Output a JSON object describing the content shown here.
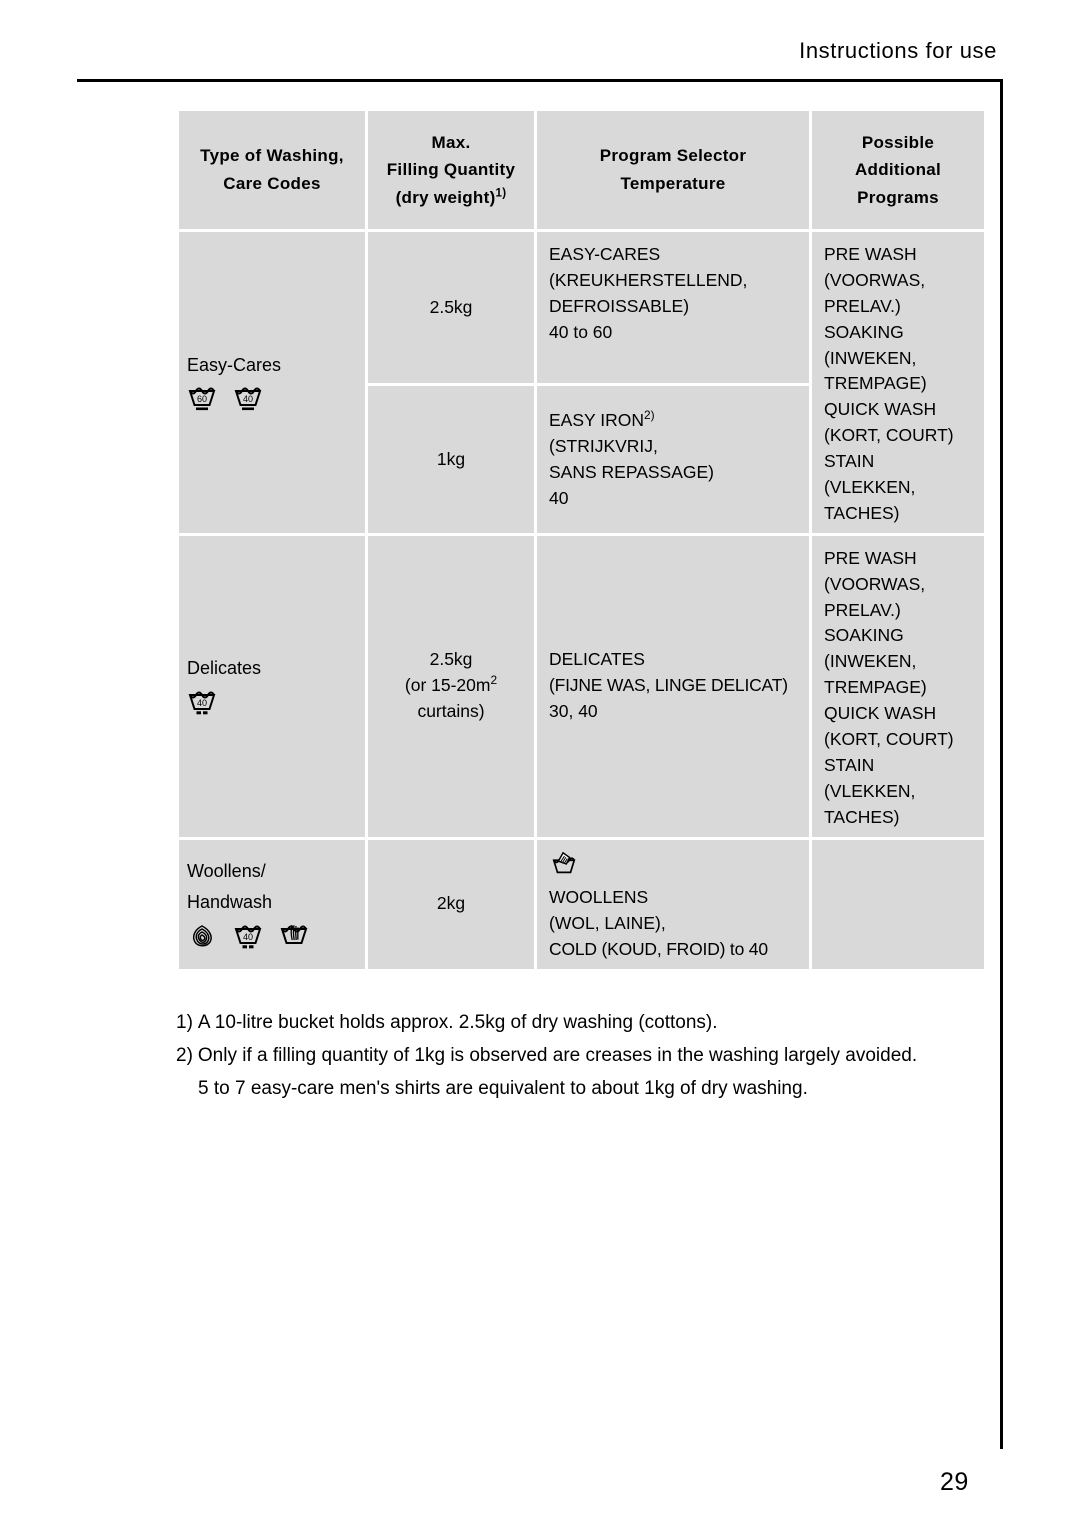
{
  "header": {
    "title": "Instructions for use"
  },
  "page_number": "29",
  "table": {
    "columns": [
      {
        "lines": [
          "Type of Washing,",
          "Care Codes"
        ]
      },
      {
        "lines": [
          "Max.",
          "Filling Quantity",
          "(dry weight)1)"
        ]
      },
      {
        "lines": [
          "Program Selector",
          "Temperature"
        ]
      },
      {
        "lines": [
          "Possible",
          "Additional",
          "Programs"
        ]
      }
    ],
    "col_headers": {
      "c1_l1": "Type of Washing,",
      "c1_l2": "Care Codes",
      "c2_l1": "Max.",
      "c2_l2": "Filling Quantity",
      "c2_l3_pre": "(dry weight)",
      "c2_l3_sup": "1)",
      "c3_l1": "Program Selector",
      "c3_l2": "Temperature",
      "c4_l1": "Possible",
      "c4_l2": "Additional",
      "c4_l3": "Programs"
    },
    "rows": [
      {
        "type_name": "Easy-Cares",
        "icons": [
          "wash-tub-60-gentle-icon",
          "wash-tub-40-gentle-icon"
        ],
        "sub_rows": [
          {
            "quantity": "2.5kg",
            "program_lines": [
              "EASY-CARES",
              "(KREUKHERSTELLEND,",
              "DEFROISSABLE)",
              "40 to 60"
            ]
          },
          {
            "quantity": "1kg",
            "program_pre": "EASY IRON",
            "program_sup": "2)",
            "program_lines": [
              "(STRIJKVRIJ,",
              "SANS REPASSAGE)",
              "40"
            ]
          }
        ],
        "additional_lines": [
          "PRE WASH",
          "(VOORWAS,",
          "PRELAV.)",
          "SOAKING",
          "(INWEKEN,",
          "TREMPAGE)",
          "QUICK WASH",
          "(KORT, COURT)",
          "STAIN",
          "(VLEKKEN,",
          "TACHES)"
        ]
      },
      {
        "type_name": "Delicates",
        "icons": [
          "wash-tub-40-very-gentle-icon"
        ],
        "quantity_lines": [
          "2.5kg",
          "(or 15-20m",
          "curtains)"
        ],
        "quantity_l1": "2.5kg",
        "quantity_l2_pre": "(or 15-20m",
        "quantity_l2_sup": "2",
        "quantity_l3": "curtains)",
        "program_lines": [
          "DELICATES",
          "(FIJNE WAS, LINGE DELICAT)",
          "30, 40"
        ],
        "additional_lines": [
          "PRE WASH",
          "(VOORWAS,",
          "PRELAV.)",
          "SOAKING",
          "(INWEKEN,",
          "TREMPAGE)",
          "QUICK WASH",
          "(KORT, COURT)",
          "STAIN",
          "(VLEKKEN,",
          "TACHES)"
        ]
      },
      {
        "type_name_l1": "Woollens/",
        "type_name_l2": "Handwash",
        "icons": [
          "wool-skein-icon",
          "wash-tub-40-very-gentle-icon",
          "handwash-tub-icon"
        ],
        "quantity": "2kg",
        "program_icon": "handwash-tub-icon",
        "program_lines": [
          "WOOLLENS",
          "(WOL, LAINE),",
          "COLD (KOUD, FROID) to 40"
        ],
        "additional_lines": []
      }
    ]
  },
  "footnotes": [
    {
      "marker": "1)",
      "text": "A 10-litre bucket holds approx. 2.5kg of dry washing (cottons)."
    },
    {
      "marker": "2)",
      "text": "Only if a filling quantity of 1kg is observed are creases in the washing largely avoided.",
      "extra": "5 to 7 easy-care men's shirts are equivalent to about 1kg of dry washing."
    }
  ],
  "colors": {
    "cell_background": "#d9d9d9",
    "page_background": "#ffffff",
    "ink": "#000000"
  }
}
